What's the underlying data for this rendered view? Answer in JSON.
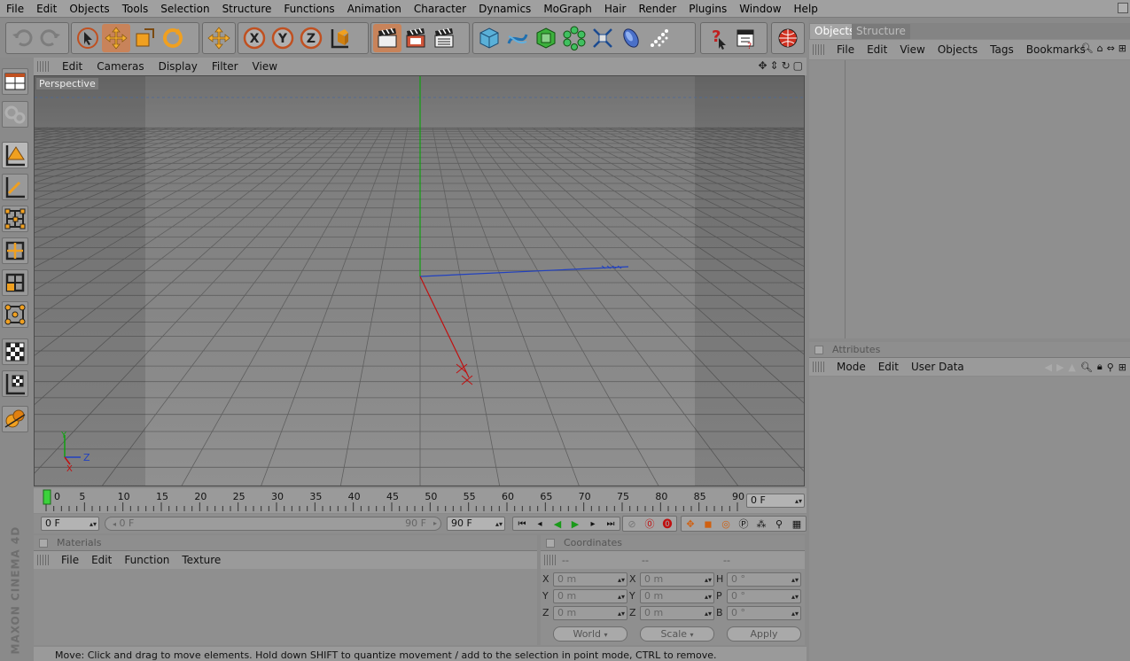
{
  "menu": [
    "File",
    "Edit",
    "Objects",
    "Tools",
    "Selection",
    "Structure",
    "Functions",
    "Animation",
    "Character",
    "Dynamics",
    "MoGraph",
    "Hair",
    "Render",
    "Plugins",
    "Window",
    "Help"
  ],
  "viewport": {
    "menu": [
      "Edit",
      "Cameras",
      "Display",
      "Filter",
      "View"
    ],
    "label": "Perspective",
    "axis": {
      "y": "Y",
      "z": "Z",
      "x": "X"
    }
  },
  "timeline": {
    "ticks": [
      "0",
      "5",
      "10",
      "15",
      "20",
      "25",
      "30",
      "35",
      "40",
      "45",
      "50",
      "55",
      "60",
      "65",
      "70",
      "75",
      "80",
      "85",
      "90"
    ],
    "current_frame": "0 F",
    "start_field": "0 F",
    "range_start": "0 F",
    "range_end": "90 F",
    "end_field": "90 F"
  },
  "materials": {
    "title": "Materials",
    "menu": [
      "File",
      "Edit",
      "Function",
      "Texture"
    ]
  },
  "coordinates": {
    "title": "Coordinates",
    "col_headers": [
      "--",
      "--",
      "--"
    ],
    "rows": [
      {
        "a": "X",
        "av": "0 m",
        "b": "X",
        "bv": "0 m",
        "c": "H",
        "cv": "0 °"
      },
      {
        "a": "Y",
        "av": "0 m",
        "b": "Y",
        "bv": "0 m",
        "c": "P",
        "cv": "0 °"
      },
      {
        "a": "Z",
        "av": "0 m",
        "b": "Z",
        "bv": "0 m",
        "c": "B",
        "cv": "0 °"
      }
    ],
    "world": "World",
    "scale": "Scale",
    "apply": "Apply"
  },
  "objects": {
    "tabs": [
      "Objects",
      "Structure"
    ],
    "menu": [
      "File",
      "Edit",
      "View",
      "Objects",
      "Tags",
      "Bookmarks"
    ]
  },
  "attributes": {
    "title": "Attributes",
    "menu": [
      "Mode",
      "Edit",
      "User Data"
    ]
  },
  "status": "Move: Click and drag to move elements. Hold down SHIFT to quantize movement / add to the selection in point mode, CTRL to remove.",
  "brand": "MAXON CINEMA 4D",
  "colors": {
    "accent": "#c8835a",
    "x_axis": "#c01010",
    "y_axis": "#10a010",
    "z_axis": "#1030c0",
    "playhead": "#3cd23c"
  }
}
